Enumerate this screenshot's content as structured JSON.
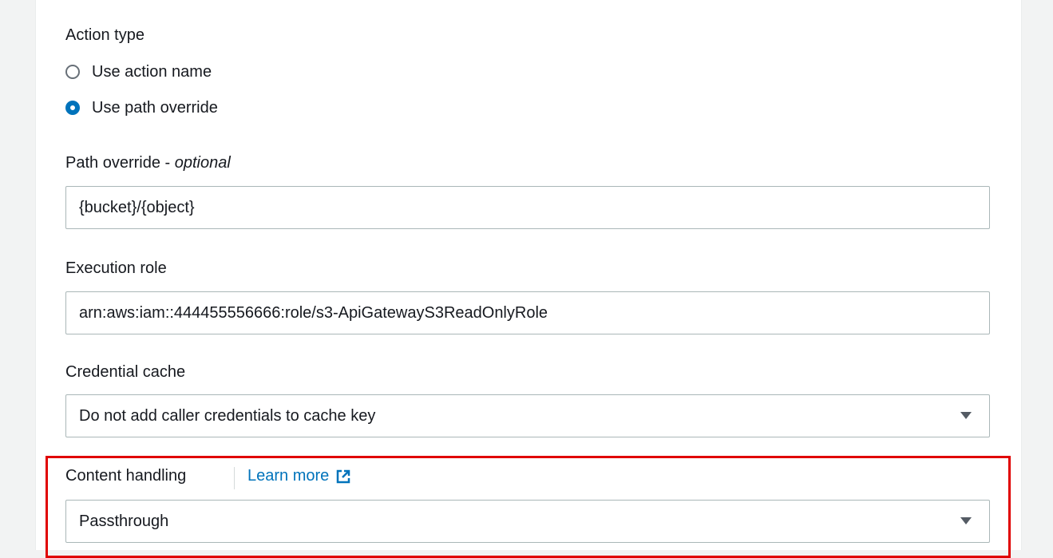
{
  "form": {
    "action_type": {
      "label": "Action type",
      "options": [
        {
          "label": "Use action name",
          "selected": false
        },
        {
          "label": "Use path override",
          "selected": true
        }
      ]
    },
    "path_override": {
      "label": "Path override - ",
      "label_suffix": "optional",
      "value": "{bucket}/{object}"
    },
    "execution_role": {
      "label": "Execution role",
      "value": "arn:aws:iam::444455556666:role/s3-ApiGatewayS3ReadOnlyRole"
    },
    "credential_cache": {
      "label": "Credential cache",
      "value": "Do not add caller credentials to cache key"
    },
    "content_handling": {
      "label": "Content handling",
      "link_label": "Learn more",
      "value": "Passthrough"
    }
  },
  "colors": {
    "accent": "#0073bb",
    "highlight": "#e00000",
    "background": "#f2f3f3"
  },
  "icons": {
    "external_link": "external-link-icon",
    "dropdown": "caret-down-icon"
  }
}
